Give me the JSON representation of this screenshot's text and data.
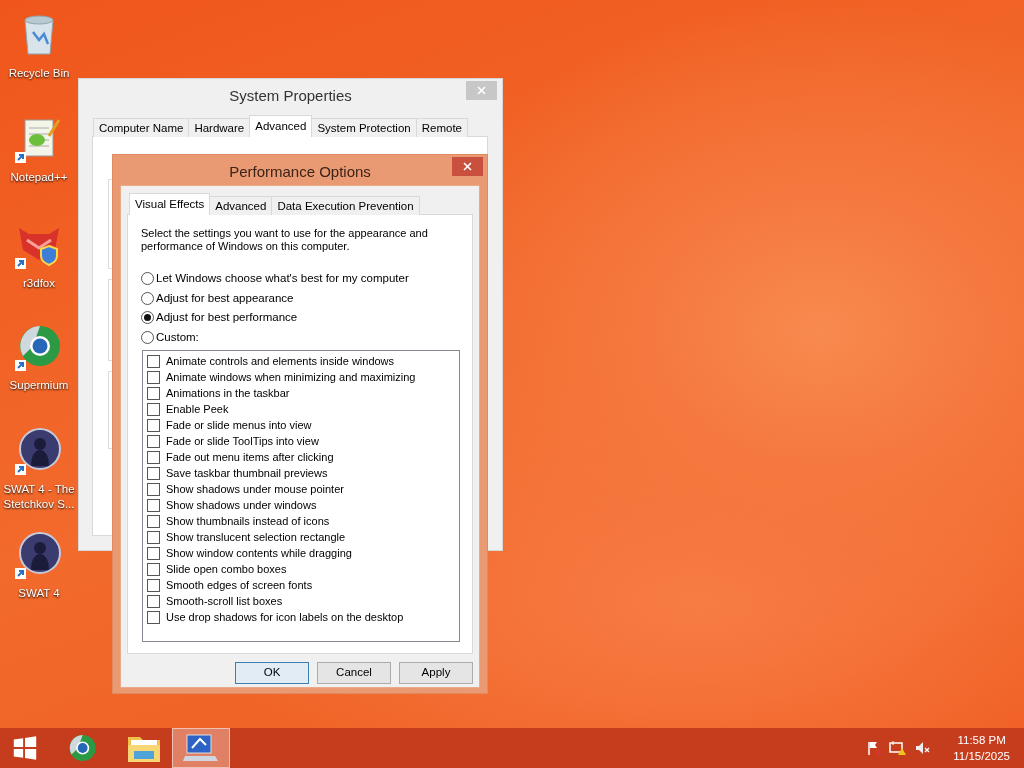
{
  "desktop_icons": [
    {
      "kind": "bin",
      "label": "Recycle Bin"
    },
    {
      "kind": "notepad",
      "label": "Notepad++"
    },
    {
      "kind": "fox",
      "label": "r3dfox"
    },
    {
      "kind": "globe",
      "label": "Supermium"
    },
    {
      "kind": "game",
      "label": "SWAT 4 - The Stetchkov S..."
    },
    {
      "kind": "game",
      "label": "SWAT 4"
    }
  ],
  "system_properties": {
    "title": "System Properties",
    "tabs": [
      {
        "label": "Computer Name",
        "selected": false
      },
      {
        "label": "Hardware",
        "selected": false
      },
      {
        "label": "Advanced",
        "selected": true
      },
      {
        "label": "System Protection",
        "selected": false
      },
      {
        "label": "Remote",
        "selected": false
      }
    ]
  },
  "performance_options": {
    "title": "Performance Options",
    "tabs": [
      {
        "label": "Visual Effects",
        "selected": true
      },
      {
        "label": "Advanced",
        "selected": false
      },
      {
        "label": "Data Execution Prevention",
        "selected": false
      }
    ],
    "description": "Select the settings you want to use for the appearance and performance of Windows on this computer.",
    "options": [
      {
        "label": "Let Windows choose what's best for my computer",
        "selected": false
      },
      {
        "label": "Adjust for best appearance",
        "selected": false
      },
      {
        "label": "Adjust for best performance",
        "selected": true
      },
      {
        "label": "Custom:",
        "selected": false
      }
    ],
    "effects": [
      {
        "label": "Animate controls and elements inside windows",
        "checked": false
      },
      {
        "label": "Animate windows when minimizing and maximizing",
        "checked": false
      },
      {
        "label": "Animations in the taskbar",
        "checked": false
      },
      {
        "label": "Enable Peek",
        "checked": false
      },
      {
        "label": "Fade or slide menus into view",
        "checked": false
      },
      {
        "label": "Fade or slide ToolTips into view",
        "checked": false
      },
      {
        "label": "Fade out menu items after clicking",
        "checked": false
      },
      {
        "label": "Save taskbar thumbnail previews",
        "checked": false
      },
      {
        "label": "Show shadows under mouse pointer",
        "checked": false
      },
      {
        "label": "Show shadows under windows",
        "checked": false
      },
      {
        "label": "Show thumbnails instead of icons",
        "checked": false
      },
      {
        "label": "Show translucent selection rectangle",
        "checked": false
      },
      {
        "label": "Show window contents while dragging",
        "checked": false
      },
      {
        "label": "Slide open combo boxes",
        "checked": false
      },
      {
        "label": "Smooth edges of screen fonts",
        "checked": false
      },
      {
        "label": "Smooth-scroll list boxes",
        "checked": false
      },
      {
        "label": "Use drop shadows for icon labels on the desktop",
        "checked": false
      }
    ],
    "buttons": [
      {
        "label": "OK",
        "default": true
      },
      {
        "label": "Cancel",
        "default": false
      },
      {
        "label": "Apply",
        "default": false
      }
    ]
  },
  "taskbar": {
    "items": [
      {
        "kind": "start",
        "selected": false
      },
      {
        "kind": "globe",
        "selected": false
      },
      {
        "kind": "folder",
        "selected": false
      },
      {
        "kind": "system",
        "selected": true
      }
    ],
    "tray": [
      {
        "kind": "flag"
      },
      {
        "kind": "network"
      },
      {
        "kind": "speaker"
      }
    ],
    "time": "11:58 PM",
    "date": "11/15/2025"
  }
}
